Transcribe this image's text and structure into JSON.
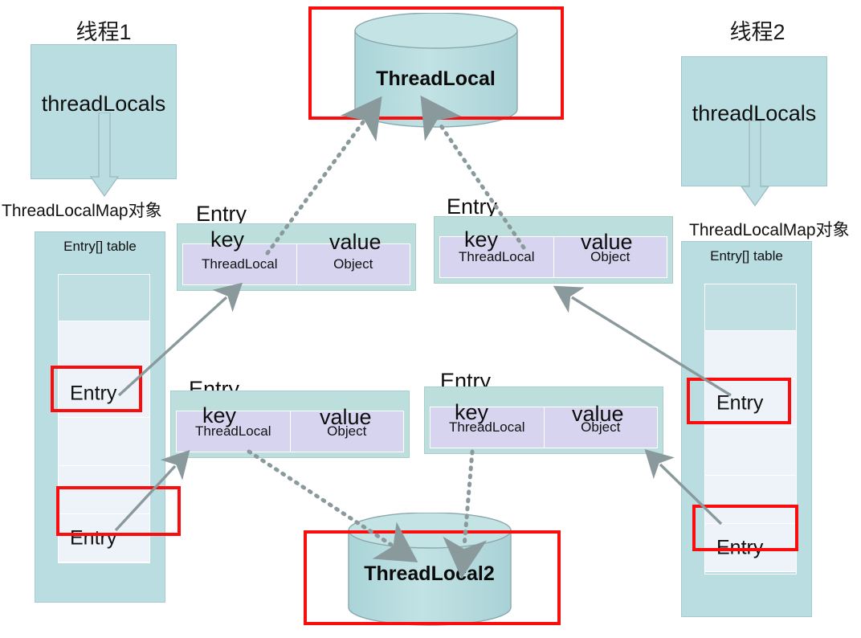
{
  "diagram": {
    "title_thread1": "线程1",
    "title_thread2": "线程2",
    "threadlocals_label": "threadLocals",
    "map_label": "ThreadLocalMap对象",
    "table_title": "Entry[] table",
    "entry_cell_label": "Entry",
    "entry_title": "Entry",
    "key_title": "key",
    "value_title": "value",
    "key_type": "ThreadLocal",
    "value_type": "Object",
    "cylinder_top": "ThreadLocal",
    "cylinder_bottom": "ThreadLocal2"
  },
  "colors": {
    "teal_panel": "#b9dde1",
    "entry_box": "#bcdfdd",
    "kv_cell": "#d6d4ef",
    "highlight_red": "#fc0d0d",
    "arrow_gray": "#8a9a9c",
    "cell_light": "#eef3f9",
    "cell_dark": "#bfdfe3"
  },
  "threads": [
    {
      "id": "thread1",
      "title": "线程1",
      "threadlocals": "threadLocals",
      "map_label": "ThreadLocalMap对象",
      "table_title": "Entry[] table",
      "entries": [
        "Entry",
        "Entry"
      ]
    },
    {
      "id": "thread2",
      "title": "线程2",
      "threadlocals": "threadLocals",
      "map_label": "ThreadLocalMap对象",
      "table_title": "Entry[] table",
      "entries": [
        "Entry",
        "Entry"
      ]
    }
  ],
  "entry_boxes": [
    {
      "id": "entry-tl",
      "title": "Entry",
      "key_title": "key",
      "value_title": "value",
      "key": "ThreadLocal",
      "value": "Object"
    },
    {
      "id": "entry-tr",
      "title": "Entry",
      "key_title": "key",
      "value_title": "value",
      "key": "ThreadLocal",
      "value": "Object"
    },
    {
      "id": "entry-bl",
      "title": "Entry",
      "key_title": "key",
      "value_title": "value",
      "key": "ThreadLocal",
      "value": "Object"
    },
    {
      "id": "entry-br",
      "title": "Entry",
      "key_title": "key",
      "value_title": "value",
      "key": "ThreadLocal",
      "value": "Object"
    }
  ],
  "cylinders": [
    {
      "id": "threadlocal-1",
      "label": "ThreadLocal"
    },
    {
      "id": "threadlocal-2",
      "label": "ThreadLocal2"
    }
  ]
}
